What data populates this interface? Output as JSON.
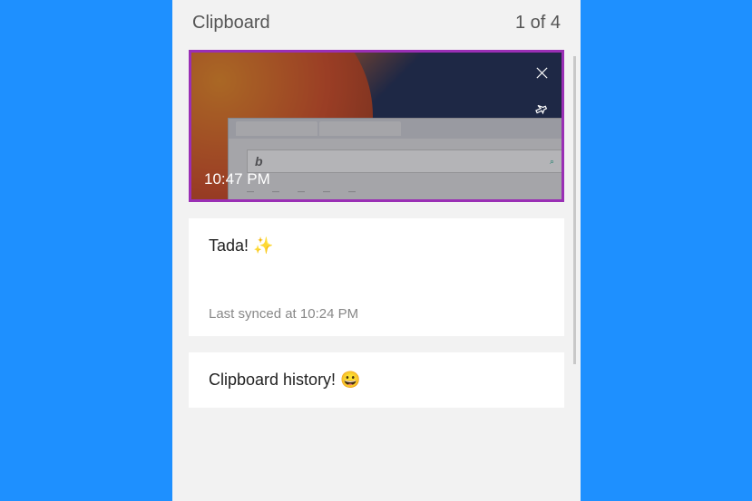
{
  "header": {
    "title": "Clipboard",
    "counter": "1 of 4"
  },
  "clips": {
    "image": {
      "timestamp": "10:47 PM"
    },
    "text1": {
      "content": "Tada! ✨",
      "sync": "Last synced at 10:24 PM"
    },
    "text2": {
      "content": "Clipboard history! 😀"
    }
  }
}
